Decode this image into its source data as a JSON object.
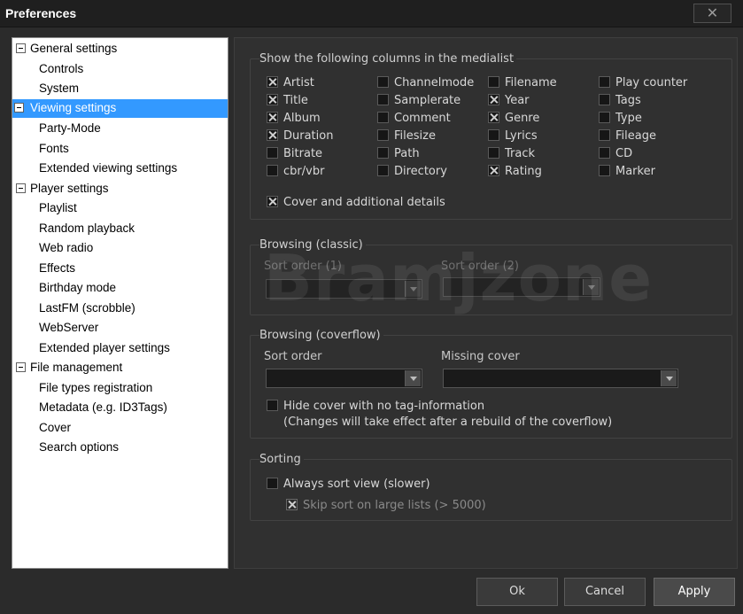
{
  "window": {
    "title": "Preferences",
    "close_label": "✕"
  },
  "tree": {
    "items": [
      {
        "label": "General settings"
      },
      {
        "label": "Controls"
      },
      {
        "label": "System"
      },
      {
        "label": "Viewing settings"
      },
      {
        "label": "Party-Mode"
      },
      {
        "label": "Fonts"
      },
      {
        "label": "Extended viewing settings"
      },
      {
        "label": "Player settings"
      },
      {
        "label": "Playlist"
      },
      {
        "label": "Random playback"
      },
      {
        "label": "Web radio"
      },
      {
        "label": "Effects"
      },
      {
        "label": "Birthday mode"
      },
      {
        "label": "LastFM (scrobble)"
      },
      {
        "label": "WebServer"
      },
      {
        "label": "Extended player settings"
      },
      {
        "label": "File management"
      },
      {
        "label": "File types registration"
      },
      {
        "label": "Metadata (e.g. ID3Tags)"
      },
      {
        "label": "Cover"
      },
      {
        "label": "Search options"
      }
    ]
  },
  "columns": {
    "title": "Show the following columns in the medialist",
    "items": [
      {
        "label": "Artist",
        "checked": true
      },
      {
        "label": "Title",
        "checked": true
      },
      {
        "label": "Album",
        "checked": true
      },
      {
        "label": "Duration",
        "checked": true
      },
      {
        "label": "Bitrate",
        "checked": false
      },
      {
        "label": "cbr/vbr",
        "checked": false
      },
      {
        "label": "Channelmode",
        "checked": false
      },
      {
        "label": "Samplerate",
        "checked": false
      },
      {
        "label": "Comment",
        "checked": false
      },
      {
        "label": "Filesize",
        "checked": false
      },
      {
        "label": "Path",
        "checked": false
      },
      {
        "label": "Directory",
        "checked": false
      },
      {
        "label": "Filename",
        "checked": false
      },
      {
        "label": "Year",
        "checked": true
      },
      {
        "label": "Genre",
        "checked": true
      },
      {
        "label": "Lyrics",
        "checked": false
      },
      {
        "label": "Track",
        "checked": false
      },
      {
        "label": "Rating",
        "checked": true
      },
      {
        "label": "Play counter",
        "checked": false
      },
      {
        "label": "Tags",
        "checked": false
      },
      {
        "label": "Type",
        "checked": false
      },
      {
        "label": "Fileage",
        "checked": false
      },
      {
        "label": "CD",
        "checked": false
      },
      {
        "label": "Marker",
        "checked": false
      }
    ],
    "cover_details": {
      "label": "Cover and additional details",
      "checked": true
    }
  },
  "browsing_classic": {
    "title": "Browsing (classic)",
    "sort1_label": "Sort order (1)",
    "sort2_label": "Sort order (2)",
    "sort1_value": "",
    "sort2_value": ""
  },
  "browsing_coverflow": {
    "title": "Browsing (coverflow)",
    "sort_label": "Sort order",
    "missing_label": "Missing cover",
    "sort_value": "",
    "missing_value": "",
    "hide_cover": {
      "label": "Hide cover with no tag-information",
      "checked": false
    },
    "note": "(Changes will take effect after a rebuild of the coverflow)"
  },
  "sorting": {
    "title": "Sorting",
    "always_sort": {
      "label": "Always sort view (slower)",
      "checked": false
    },
    "skip_sort": {
      "label": "Skip sort on large lists (> 5000)",
      "checked": true
    }
  },
  "watermark": "Bramjzone",
  "buttons": {
    "ok": "Ok",
    "cancel": "Cancel",
    "apply": "Apply"
  }
}
